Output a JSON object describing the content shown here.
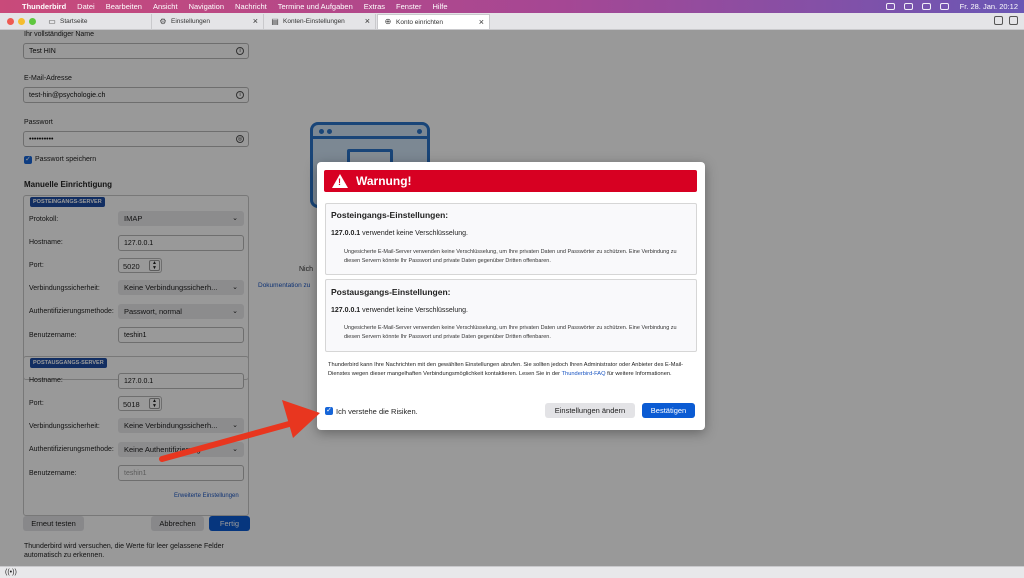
{
  "menubar": {
    "app": "Thunderbird",
    "items": [
      "Datei",
      "Bearbeiten",
      "Ansicht",
      "Navigation",
      "Nachricht",
      "Termine und Aufgaben",
      "Extras",
      "Fenster",
      "Hilfe"
    ],
    "clock": "Fr. 28. Jan.  20:12"
  },
  "tabs": [
    {
      "label": "Startseite",
      "icon": "folder-icon"
    },
    {
      "label": "Einstellungen",
      "icon": "gear-icon"
    },
    {
      "label": "Konten-Einstellungen",
      "icon": "account-icon"
    },
    {
      "label": "Konto einrichten",
      "icon": "globe-icon"
    }
  ],
  "form": {
    "name_label": "Ihr vollständiger Name",
    "name_value": "Test HIN",
    "email_label": "E-Mail-Adresse",
    "email_value": "test-hin@psychologie.ch",
    "password_label": "Passwort",
    "password_value": "••••••••••",
    "save_password": "Passwort speichern",
    "manual_title": "Manuelle Einrichtigung",
    "incoming": {
      "badge": "POSTEINGANGS-SERVER",
      "protocol_label": "Protokoll:",
      "protocol_value": "IMAP",
      "hostname_label": "Hostname:",
      "hostname_value": "127.0.0.1",
      "port_label": "Port:",
      "port_value": "5020",
      "security_label": "Verbindungssicherheit:",
      "security_value": "Keine Verbindungssicherh...",
      "auth_label": "Authentifizierungsmethode:",
      "auth_value": "Passwort, normal",
      "user_label": "Benutzername:",
      "user_value": "teshin1"
    },
    "outgoing": {
      "badge": "POSTAUSGANGS-SERVER",
      "hostname_label": "Hostname:",
      "hostname_value": "127.0.0.1",
      "port_label": "Port:",
      "port_value": "5018",
      "security_label": "Verbindungssicherheit:",
      "security_value": "Keine Verbindungssicherh...",
      "auth_label": "Authentifizierungsmethode:",
      "auth_value": "Keine Authentifizierung",
      "user_label": "Benutzername:",
      "user_value": "teshin1"
    },
    "advanced_link": "Erweiterte Einstellungen",
    "retest": "Erneut testen",
    "cancel": "Abbrechen",
    "done": "Fertig",
    "footnote": "Thunderbird wird versuchen, die Werte für leer gelassene Felder automatisch zu erkennen."
  },
  "side": {
    "text_fragment": "Nich",
    "doc_link": "Dokumentation zu"
  },
  "dialog": {
    "title": "Warnung!",
    "incoming_title": "Posteingangs-Einstellungen:",
    "incoming_host": "127.0.0.1",
    "incoming_msg": "verwendet keine Verschlüsselung.",
    "incoming_desc": "Ungesicherte E-Mail-Server verwenden keine Verschlüsselung, um Ihre privaten Daten und Passwörter zu schützen. Eine Verbindung zu diesen Servern könnte Ihr Passwort und private Daten gegenüber Dritten offenbaren.",
    "outgoing_title": "Postausgangs-Einstellungen:",
    "outgoing_host": "127.0.0.1",
    "outgoing_msg": "verwendet keine Verschlüsselung.",
    "outgoing_desc": "Ungesicherte E-Mail-Server verwenden keine Verschlüsselung, um Ihre privaten Daten und Passwörter zu schützen. Eine Verbindung zu diesen Servern könnte Ihr Passwort und private Daten gegenüber Dritten offenbaren.",
    "note_text": "Thunderbird kann Ihre Nachrichten mit den gewählten Einstellungen abrufen. Sie sollten jedoch Ihren Administrator oder Anbieter des E-Mail-Dienstes wegen dieser mangelhaften Verbindungsmöglichkeit kontaktieren. Lesen Sie in der",
    "note_link": "Thunderbird-FAQ",
    "note_tail": "für weitere Informationen.",
    "accept_risk": "Ich verstehe die Risiken.",
    "change_settings": "Einstellungen ändern",
    "confirm": "Bestätigen"
  },
  "colors": {
    "warning_red": "#d70022",
    "primary_blue": "#0b5bd3",
    "arrow_red": "#e8361f"
  }
}
